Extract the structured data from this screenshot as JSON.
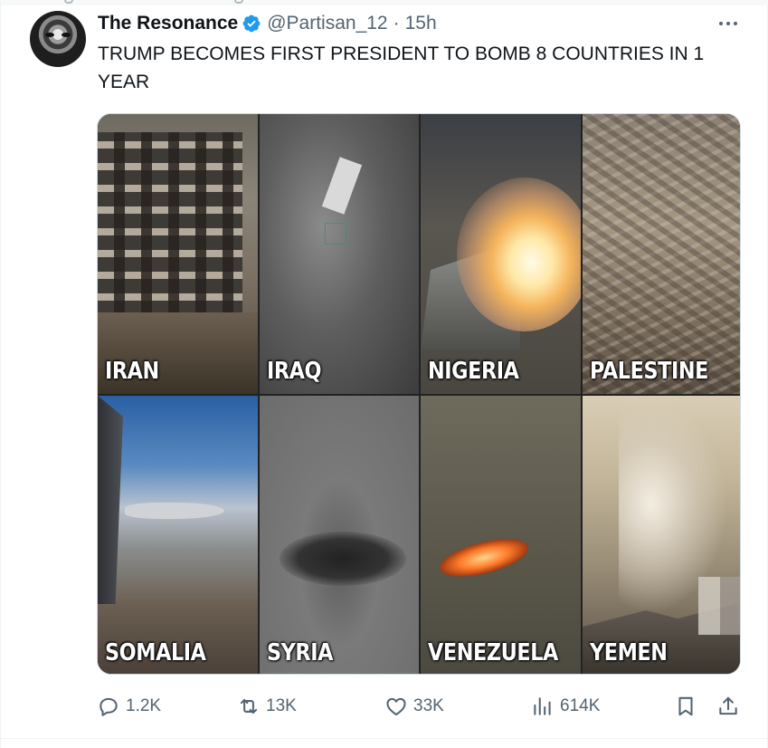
{
  "tweet": {
    "display_name": "The Resonance",
    "verified": true,
    "handle": "@Partisan_12",
    "separator": "·",
    "time": "15h",
    "text": "TRUMP BECOMES FIRST PRESIDENT TO BOMB 8 COUNTRIES IN 1 YEAR"
  },
  "media": {
    "tiles": [
      {
        "label": "IRAN"
      },
      {
        "label": "IRAQ"
      },
      {
        "label": "NIGERIA"
      },
      {
        "label": "PALESTINE"
      },
      {
        "label": "SOMALIA"
      },
      {
        "label": "SYRIA"
      },
      {
        "label": "VENEZUELA"
      },
      {
        "label": "YEMEN"
      }
    ]
  },
  "actions": {
    "replies": "1.2K",
    "reposts": "13K",
    "likes": "33K",
    "views": "614K"
  },
  "icons": {
    "reply": "reply-icon",
    "repost": "repost-icon",
    "like": "heart-icon",
    "views": "views-icon",
    "bookmark": "bookmark-icon",
    "share": "share-icon",
    "more": "more-options-icon",
    "verified": "verified-badge-icon"
  },
  "colors": {
    "text_primary": "#0f1419",
    "text_secondary": "#536471",
    "verified_blue": "#1d9bf0"
  }
}
